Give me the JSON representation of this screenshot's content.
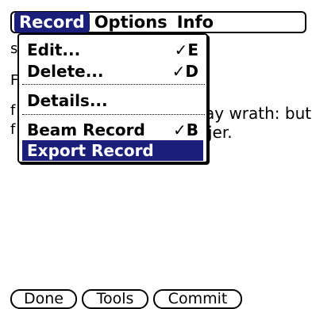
{
  "menubar": {
    "items": [
      {
        "label": "Record",
        "active": true
      },
      {
        "label": "Options",
        "active": false
      },
      {
        "label": "Info",
        "active": false
      }
    ]
  },
  "menu": {
    "items": [
      {
        "label": "Edit...",
        "shortcut": "✓E",
        "selected": false
      },
      {
        "label": "Delete...",
        "shortcut": "✓D",
        "selected": false
      },
      {
        "label": "Details...",
        "shortcut": "",
        "selected": false
      },
      {
        "label": "Beam Record",
        "shortcut": "✓B",
        "selected": false
      },
      {
        "label": "Export Record",
        "shortcut": "",
        "selected": true
      }
    ]
  },
  "background": {
    "line1": "ay wrath: but",
    "line2": "jer.",
    "left_chars": [
      "s",
      "F",
      "f",
      "f"
    ]
  },
  "buttons": {
    "done": "Done",
    "tools": "Tools",
    "commit": "Commit"
  },
  "colors": {
    "highlight": "#1c1f7a"
  }
}
